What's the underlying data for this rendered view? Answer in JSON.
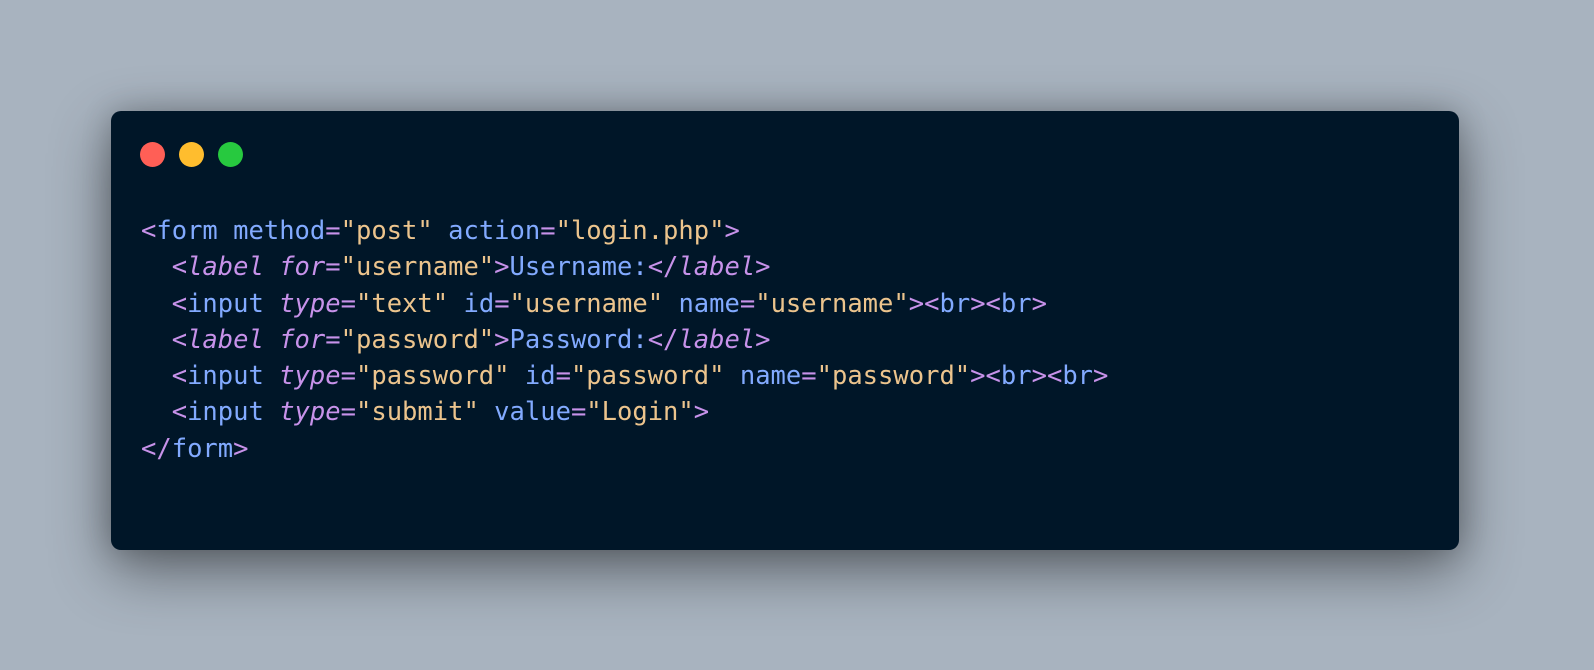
{
  "window": {
    "buttons": [
      {
        "name": "close",
        "color": "#ff5f56"
      },
      {
        "name": "minimize",
        "color": "#ffbd2e"
      },
      {
        "name": "maximize",
        "color": "#27c93f"
      }
    ]
  },
  "colors": {
    "punct": "#c792ea",
    "tag": "#82aaff",
    "attr": "#82aaff",
    "attr_italic": "#c792ea",
    "string": "#ecc48d",
    "text": "#82aaff"
  },
  "code": {
    "lines": [
      [
        {
          "t": "<",
          "c": "punct"
        },
        {
          "t": "form",
          "c": "tag"
        },
        {
          "t": " ",
          "c": "text"
        },
        {
          "t": "method",
          "c": "attr"
        },
        {
          "t": "=",
          "c": "punct"
        },
        {
          "t": "\"post\"",
          "c": "string"
        },
        {
          "t": " ",
          "c": "text"
        },
        {
          "t": "action",
          "c": "attr"
        },
        {
          "t": "=",
          "c": "punct"
        },
        {
          "t": "\"login.php\"",
          "c": "string"
        },
        {
          "t": ">",
          "c": "punct"
        }
      ],
      [
        {
          "t": "  ",
          "c": "text"
        },
        {
          "t": "<",
          "c": "punct"
        },
        {
          "t": "label",
          "c": "attr_italic",
          "i": true
        },
        {
          "t": " ",
          "c": "text"
        },
        {
          "t": "for",
          "c": "attr_italic",
          "i": true
        },
        {
          "t": "=",
          "c": "punct"
        },
        {
          "t": "\"username\"",
          "c": "string"
        },
        {
          "t": ">",
          "c": "punct"
        },
        {
          "t": "Username:",
          "c": "text"
        },
        {
          "t": "</",
          "c": "punct"
        },
        {
          "t": "label",
          "c": "attr_italic",
          "i": true
        },
        {
          "t": ">",
          "c": "punct"
        }
      ],
      [
        {
          "t": "  ",
          "c": "text"
        },
        {
          "t": "<",
          "c": "punct"
        },
        {
          "t": "input",
          "c": "tag"
        },
        {
          "t": " ",
          "c": "text"
        },
        {
          "t": "type",
          "c": "attr_italic",
          "i": true
        },
        {
          "t": "=",
          "c": "punct"
        },
        {
          "t": "\"text\"",
          "c": "string"
        },
        {
          "t": " ",
          "c": "text"
        },
        {
          "t": "id",
          "c": "attr"
        },
        {
          "t": "=",
          "c": "punct"
        },
        {
          "t": "\"username\"",
          "c": "string"
        },
        {
          "t": " ",
          "c": "text"
        },
        {
          "t": "name",
          "c": "attr"
        },
        {
          "t": "=",
          "c": "punct"
        },
        {
          "t": "\"username\"",
          "c": "string"
        },
        {
          "t": "><",
          "c": "punct"
        },
        {
          "t": "br",
          "c": "tag"
        },
        {
          "t": "><",
          "c": "punct"
        },
        {
          "t": "br",
          "c": "tag"
        },
        {
          "t": ">",
          "c": "punct"
        }
      ],
      [
        {
          "t": "  ",
          "c": "text"
        },
        {
          "t": "<",
          "c": "punct"
        },
        {
          "t": "label",
          "c": "attr_italic",
          "i": true
        },
        {
          "t": " ",
          "c": "text"
        },
        {
          "t": "for",
          "c": "attr_italic",
          "i": true
        },
        {
          "t": "=",
          "c": "punct"
        },
        {
          "t": "\"password\"",
          "c": "string"
        },
        {
          "t": ">",
          "c": "punct"
        },
        {
          "t": "Password:",
          "c": "text"
        },
        {
          "t": "</",
          "c": "punct"
        },
        {
          "t": "label",
          "c": "attr_italic",
          "i": true
        },
        {
          "t": ">",
          "c": "punct"
        }
      ],
      [
        {
          "t": "  ",
          "c": "text"
        },
        {
          "t": "<",
          "c": "punct"
        },
        {
          "t": "input",
          "c": "tag"
        },
        {
          "t": " ",
          "c": "text"
        },
        {
          "t": "type",
          "c": "attr_italic",
          "i": true
        },
        {
          "t": "=",
          "c": "punct"
        },
        {
          "t": "\"password\"",
          "c": "string"
        },
        {
          "t": " ",
          "c": "text"
        },
        {
          "t": "id",
          "c": "attr"
        },
        {
          "t": "=",
          "c": "punct"
        },
        {
          "t": "\"password\"",
          "c": "string"
        },
        {
          "t": " ",
          "c": "text"
        },
        {
          "t": "name",
          "c": "attr"
        },
        {
          "t": "=",
          "c": "punct"
        },
        {
          "t": "\"password\"",
          "c": "string"
        },
        {
          "t": "><",
          "c": "punct"
        },
        {
          "t": "br",
          "c": "tag"
        },
        {
          "t": "><",
          "c": "punct"
        },
        {
          "t": "br",
          "c": "tag"
        },
        {
          "t": ">",
          "c": "punct"
        }
      ],
      [
        {
          "t": "  ",
          "c": "text"
        },
        {
          "t": "<",
          "c": "punct"
        },
        {
          "t": "input",
          "c": "tag"
        },
        {
          "t": " ",
          "c": "text"
        },
        {
          "t": "type",
          "c": "attr_italic",
          "i": true
        },
        {
          "t": "=",
          "c": "punct"
        },
        {
          "t": "\"submit\"",
          "c": "string"
        },
        {
          "t": " ",
          "c": "text"
        },
        {
          "t": "value",
          "c": "attr"
        },
        {
          "t": "=",
          "c": "punct"
        },
        {
          "t": "\"Login\"",
          "c": "string"
        },
        {
          "t": ">",
          "c": "punct"
        }
      ],
      [
        {
          "t": "</",
          "c": "punct"
        },
        {
          "t": "form",
          "c": "tag"
        },
        {
          "t": ">",
          "c": "punct"
        }
      ]
    ]
  }
}
